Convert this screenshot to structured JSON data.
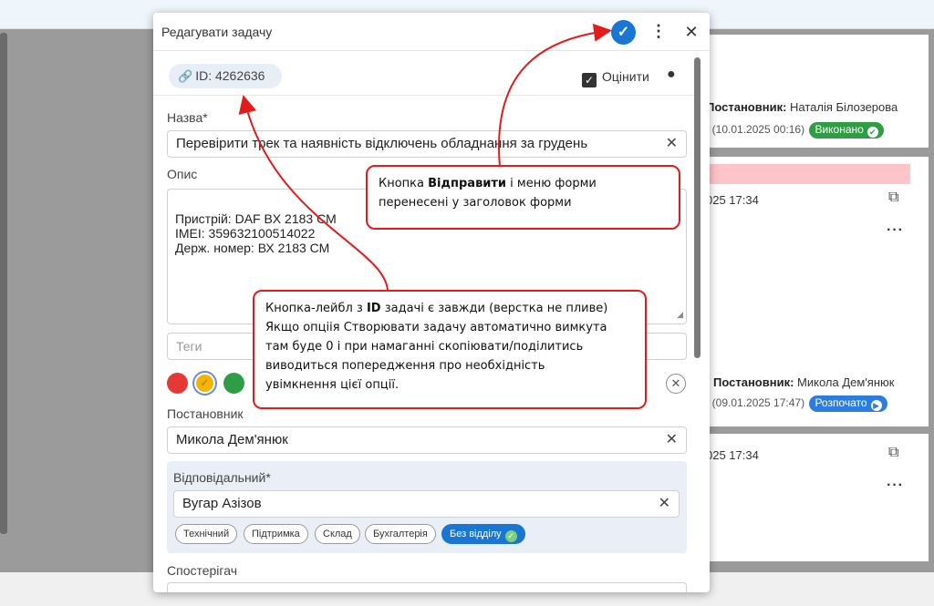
{
  "modal": {
    "title": "Редагувати задачу",
    "id_label": "ID: 4262636",
    "rate_label": "Оцінити",
    "name_label": "Назва*",
    "name_value": "Перевірити трек та наявність відключень обладнання за грудень",
    "desc_label": "Опис",
    "desc_value": "Пристрій: DAF BX 2183 CM\nIMEI: 359632100514022\nДерж. номер: ВХ 2183 СМ",
    "tags_placeholder": "Теги",
    "colors": [
      "#e53935",
      "#f5b400",
      "#2e9d44"
    ],
    "author_label": "Постановник",
    "author_value": "Микола Дем'янюк",
    "responsible_label": "Відповідальний*",
    "responsible_value": "Вугар Азізов",
    "departments": [
      "Технічний",
      "Підтримка",
      "Склад",
      "Бухгалтерія",
      "Без відділу"
    ],
    "observer_label": "Спостерігач"
  },
  "background": {
    "card1": {
      "author_key": "Постановник:",
      "author_value": "Наталія Білозерова",
      "date": ": (10.01.2025 00:16)",
      "status": "Виконано"
    },
    "card2": {
      "date": "025 17:34",
      "author_key": "Постановник:",
      "author_value": "Микола Дем'янюк",
      "date2": ": (09.01.2025 17:47)",
      "status": "Розпочато"
    },
    "card3": {
      "date": "025 17:34"
    }
  },
  "callouts": {
    "c1_line1_pre": "Кнопка ",
    "c1_line1_bold": "Відправити",
    "c1_line1_post": " і меню форми",
    "c1_line2": "перенесені у заголовок форми",
    "c2_line1_pre": "Кнопка-лейбл з ",
    "c2_line1_bold": "ID",
    "c2_line1_post": " задачі є завжди (верстка не пливе)",
    "c2_line2": "Якщо опціія Створювати задачу автоматично вимкута",
    "c2_line3": "там буде 0 і при намаганні скопіювати/поділитись",
    "c2_line4": "виводиться попередження про необхідність",
    "c2_line5": "увімкнення цієї опції."
  },
  "colors": {
    "accent": "#1976d2",
    "annotation": "#e21b1b"
  }
}
